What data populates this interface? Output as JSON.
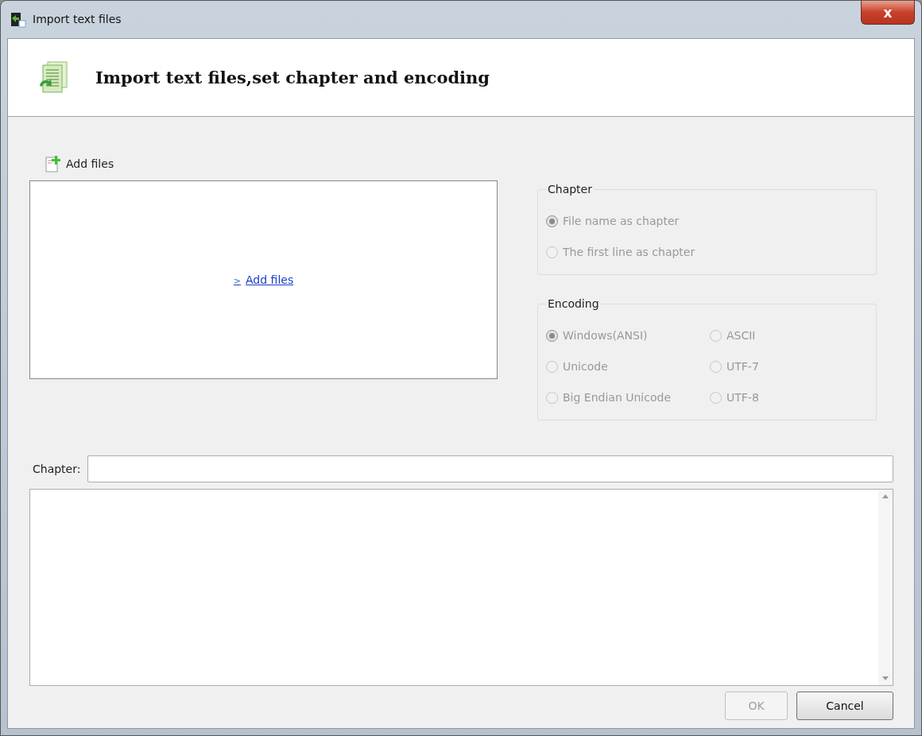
{
  "window": {
    "title": "Import text files",
    "close_glyph": "x"
  },
  "header": {
    "title": "Import text files,set chapter and encoding"
  },
  "toolbar": {
    "add_button": "Add files"
  },
  "file_list": {
    "empty_link_arrow": ">",
    "empty_link": "Add files"
  },
  "chapter_group": {
    "title": "Chapter",
    "disabled": true,
    "options": [
      {
        "label": "File name as chapter",
        "selected": true
      },
      {
        "label": "The first line as chapter",
        "selected": false
      }
    ]
  },
  "encoding_group": {
    "title": "Encoding",
    "disabled": true,
    "options": [
      {
        "label": "Windows(ANSI)",
        "selected": true
      },
      {
        "label": "ASCII",
        "selected": false
      },
      {
        "label": "Unicode",
        "selected": false
      },
      {
        "label": "UTF-7",
        "selected": false
      },
      {
        "label": "Big Endian Unicode",
        "selected": false
      },
      {
        "label": "UTF-8",
        "selected": false
      }
    ]
  },
  "chapter_field": {
    "label": "Chapter:"
  },
  "buttons": [
    {
      "label": "OK",
      "disabled": true
    },
    {
      "label": "Cancel",
      "disabled": false
    }
  ]
}
